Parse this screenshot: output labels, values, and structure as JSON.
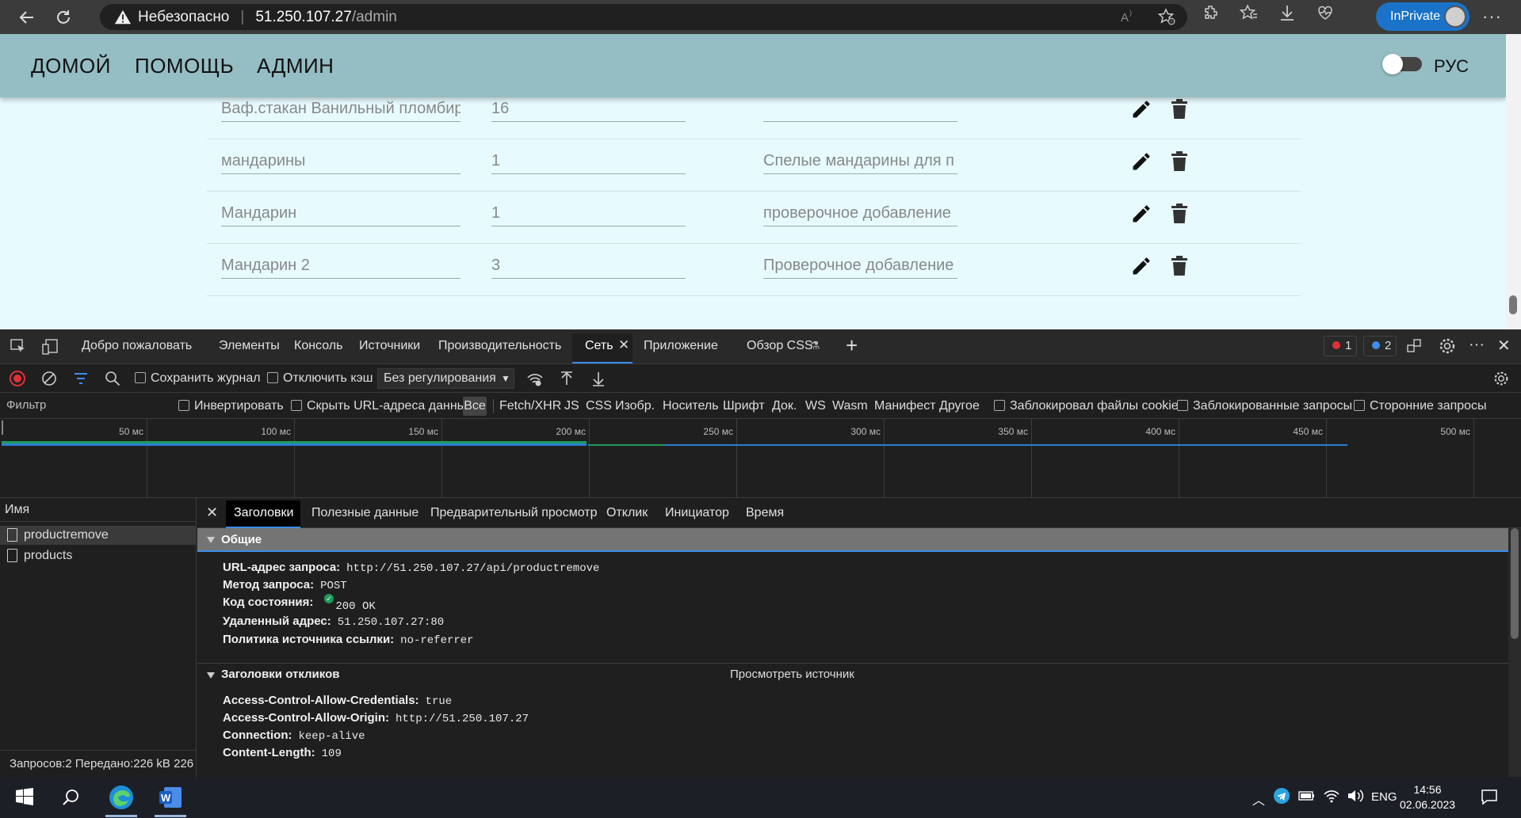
{
  "browser": {
    "security_label": "Небезопасно",
    "url_host": "51.250.107.27",
    "url_path": "/admin",
    "inprivate_label": "InPrivate",
    "accent": "#1a73c8"
  },
  "app": {
    "nav": {
      "home": "ДОМОЙ",
      "help": "ПОМОЩЬ",
      "admin": "АДМИН"
    },
    "lang_label": "РУС",
    "header_color": "#95bdc4",
    "background": "#e7fbff",
    "products": [
      {
        "name": "Ваф.стакан Ванильный пломбир",
        "qty": "16",
        "desc": ""
      },
      {
        "name": "мандарины",
        "qty": "1",
        "desc": "Спелые мандарины для п"
      },
      {
        "name": "Мандарин",
        "qty": "1",
        "desc": "проверочное добавление"
      },
      {
        "name": "Мандарин 2",
        "qty": "3",
        "desc": "Проверочное добавление"
      }
    ]
  },
  "devtools": {
    "tabs": {
      "welcome": "Добро пожаловать",
      "elements": "Элементы",
      "console": "Консоль",
      "sources": "Источники",
      "performance": "Производительность",
      "network": "Сеть",
      "application": "Приложение",
      "css_overview": "Обзор CSS"
    },
    "error_count": "1",
    "info_count": "2",
    "toolbar": {
      "preserve_log": "Сохранить журнал",
      "disable_cache": "Отключить кэш",
      "throttling": "Без регулирования"
    },
    "filterbar": {
      "filter_placeholder": "Фильтр",
      "invert": "Инвертировать",
      "hide_data_urls": "Скрыть URL-адреса данных",
      "types": [
        "Все",
        "Fetch/XHR",
        "JS",
        "CSS",
        "Изобр.",
        "Носитель",
        "Шрифт",
        "Док.",
        "WS",
        "Wasm",
        "Манифест",
        "Другое"
      ],
      "blocked_cookies": "Заблокировал файлы cookie",
      "blocked_requests": "Заблокированные запросы",
      "third_party": "Сторонние запросы"
    },
    "timeline_ticks": [
      "50 мс",
      "100 мс",
      "150 мс",
      "200 мс",
      "250 мс",
      "300 мс",
      "350 мс",
      "400 мс",
      "450 мс",
      "500 мс"
    ],
    "name_header": "Имя",
    "requests": [
      "productremove",
      "products"
    ],
    "status_bar": "Запросов:2  Передано:226 kB  226",
    "detail_tabs": {
      "headers": "Заголовки",
      "payload": "Полезные данные",
      "preview": "Предварительный просмотр",
      "response": "Отклик",
      "initiator": "Инициатор",
      "timing": "Время"
    },
    "general": {
      "title": "Общие",
      "request_url_label": "URL-адрес запроса:",
      "request_url": "http://51.250.107.27/api/productremove",
      "method_label": "Метод запроса:",
      "method": "POST",
      "status_label": "Код состояния:",
      "status": "200 OK",
      "remote_label": "Удаленный адрес:",
      "remote": "51.250.107.27:80",
      "referrer_label": "Политика источника ссылки:",
      "referrer": "no-referrer"
    },
    "response_headers": {
      "title": "Заголовки откликов",
      "view_source": "Просмотреть источник",
      "items": [
        {
          "k": "Access-Control-Allow-Credentials:",
          "v": "true"
        },
        {
          "k": "Access-Control-Allow-Origin:",
          "v": "http://51.250.107.27"
        },
        {
          "k": "Connection:",
          "v": "keep-alive"
        },
        {
          "k": "Content-Length:",
          "v": "109"
        }
      ]
    }
  },
  "taskbar": {
    "lang": "ENG",
    "time": "14:56",
    "date": "02.06.2023"
  }
}
